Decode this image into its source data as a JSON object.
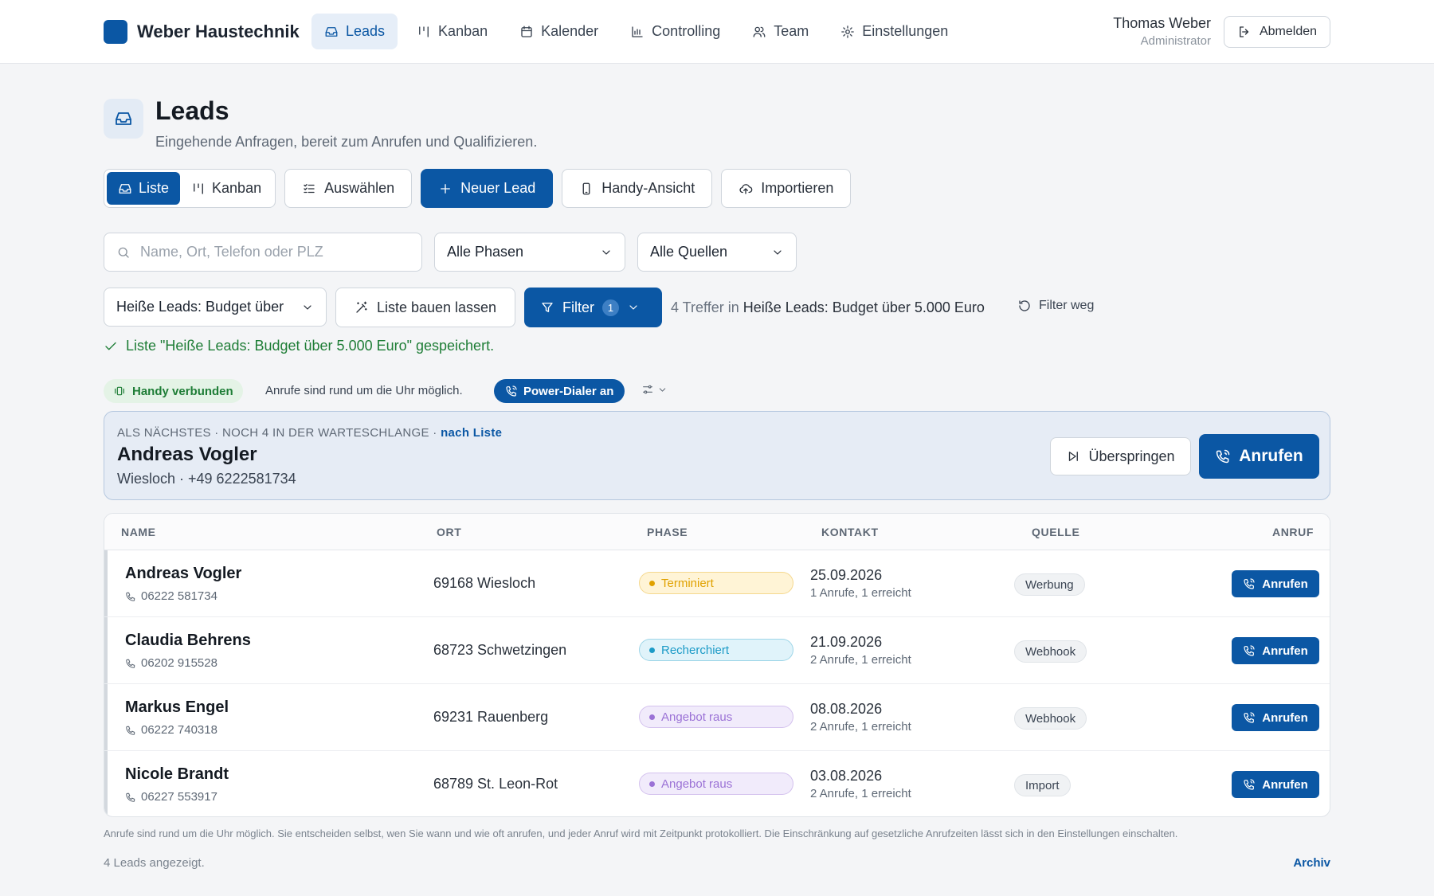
{
  "brand": {
    "name": "Weber Haustechnik",
    "color": "#0b57a4"
  },
  "nav": [
    {
      "label": "Leads",
      "icon": "inbox-icon",
      "active": true
    },
    {
      "label": "Kanban",
      "icon": "kanban-icon"
    },
    {
      "label": "Kalender",
      "icon": "calendar-icon"
    },
    {
      "label": "Controlling",
      "icon": "bar-chart-icon"
    },
    {
      "label": "Team",
      "icon": "users-icon"
    },
    {
      "label": "Einstellungen",
      "icon": "gear-icon"
    }
  ],
  "user": {
    "name": "Thomas Weber",
    "role": "Administrator",
    "logout_label": "Abmelden"
  },
  "page": {
    "title": "Leads",
    "subtitle": "Eingehende Anfragen, bereit zum Anrufen und Qualifizieren."
  },
  "toolbar": {
    "view_list": "Liste",
    "view_kanban": "Kanban",
    "select": "Auswählen",
    "new_lead": "Neuer Lead",
    "mobile_view": "Handy-Ansicht",
    "import": "Importieren"
  },
  "filters": {
    "search_placeholder": "Name, Ort, Telefon oder PLZ",
    "phase_select": "Alle Phasen",
    "source_select": "Alle Quellen",
    "saved_list_select": "Heiße Leads: Budget über",
    "build_list": "Liste bauen lassen",
    "filter_label": "Filter",
    "filter_count": "1",
    "result_prefix": "4 Treffer in",
    "result_list": "Heiße Leads: Budget über 5.000 Euro",
    "clear_label": "Filter weg",
    "saved_message": "Liste \"Heiße Leads: Budget über 5.000 Euro\" gespeichert."
  },
  "status": {
    "connected": "Handy verbunden",
    "hours_text": "Anrufe sind rund um die Uhr möglich.",
    "dialer": "Power-Dialer an"
  },
  "next": {
    "label": "ALS NÄCHSTES · NOCH 4 IN DER WARTESCHLANGE ·",
    "label_link": "nach Liste",
    "name": "Andreas Vogler",
    "meta": "Wiesloch · +49 6222581734",
    "skip": "Überspringen",
    "call": "Anrufen"
  },
  "table": {
    "columns": [
      "NAME",
      "ORT",
      "PHASE",
      "KONTAKT",
      "QUELLE",
      "ANRUF"
    ],
    "rows": [
      {
        "name": "Andreas Vogler",
        "phone": "06222 581734",
        "ort": "69168 Wiesloch",
        "phase": "Terminiert",
        "phase_color": "#e0a100",
        "phase_bg": "#fff4d6",
        "date": "25.09.2026",
        "calls": "1 Anrufe, 1 erreicht",
        "source": "Werbung",
        "call": "Anrufen"
      },
      {
        "name": "Claudia Behrens",
        "phone": "06202 915528",
        "ort": "68723 Schwetzingen",
        "phase": "Recherchiert",
        "phase_color": "#1c9bc7",
        "phase_bg": "#e0f3fa",
        "date": "21.09.2026",
        "calls": "2 Anrufe, 1 erreicht",
        "source": "Webhook",
        "call": "Anrufen"
      },
      {
        "name": "Markus Engel",
        "phone": "06222 740318",
        "ort": "69231 Rauenberg",
        "phase": "Angebot raus",
        "phase_color": "#9b72d6",
        "phase_bg": "#f1ebfb",
        "date": "08.08.2026",
        "calls": "2 Anrufe, 1 erreicht",
        "source": "Webhook",
        "call": "Anrufen"
      },
      {
        "name": "Nicole Brandt",
        "phone": "06227 553917",
        "ort": "68789 St. Leon-Rot",
        "phase": "Angebot raus",
        "phase_color": "#9b72d6",
        "phase_bg": "#f1ebfb",
        "date": "03.08.2026",
        "calls": "2 Anrufe, 1 erreicht",
        "source": "Import",
        "call": "Anrufen"
      }
    ]
  },
  "footer": {
    "note": "Anrufe sind rund um die Uhr möglich. Sie entscheiden selbst, wen Sie wann und wie oft anrufen, und jeder Anruf wird mit Zeitpunkt protokolliert. Die Einschränkung auf gesetzliche Anrufzeiten lässt sich in den Einstellungen einschalten.",
    "shown": "4 Leads angezeigt.",
    "archive": "Archiv"
  }
}
